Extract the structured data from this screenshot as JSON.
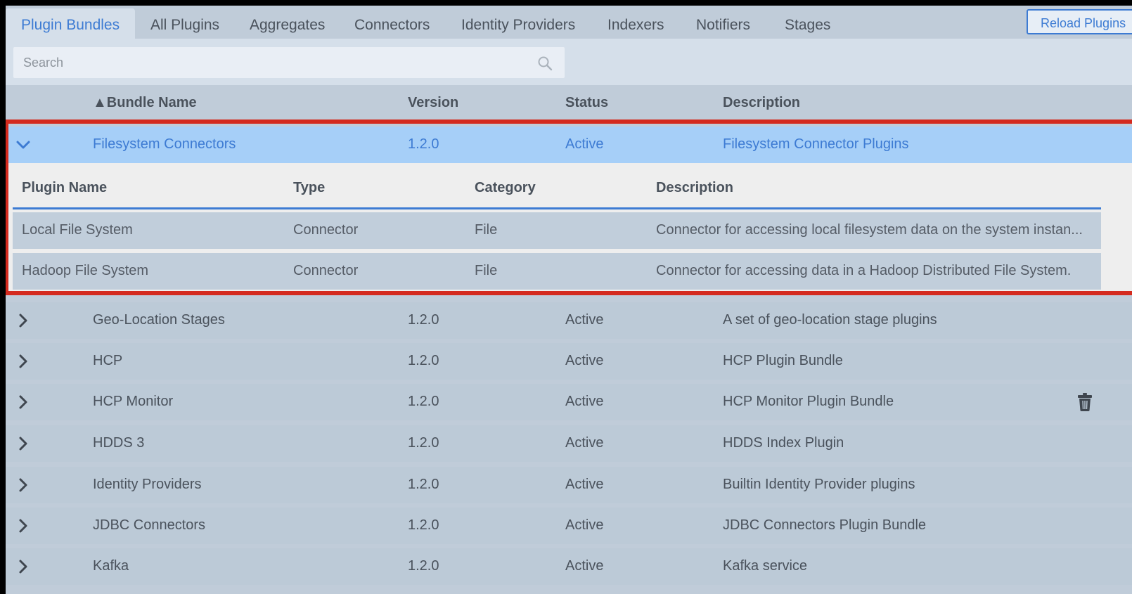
{
  "tabs": [
    {
      "label": "Plugin Bundles",
      "active": true
    },
    {
      "label": "All Plugins"
    },
    {
      "label": "Aggregates"
    },
    {
      "label": "Connectors"
    },
    {
      "label": "Identity Providers"
    },
    {
      "label": "Indexers"
    },
    {
      "label": "Notifiers"
    },
    {
      "label": "Stages"
    }
  ],
  "reload_label": "Reload Plugins",
  "search": {
    "placeholder": "Search",
    "value": ""
  },
  "columns": {
    "bundle_name": "▲Bundle Name",
    "version": "Version",
    "status": "Status",
    "description": "Description"
  },
  "expanded_bundle": {
    "name": "Filesystem Connectors",
    "version": "1.2.0",
    "status": "Active",
    "description": "Filesystem Connector Plugins"
  },
  "sub_columns": {
    "plugin_name": "Plugin Name",
    "type": "Type",
    "category": "Category",
    "description": "Description"
  },
  "plugins": [
    {
      "name": "Local File System",
      "type": "Connector",
      "category": "File",
      "description": "Connector for accessing local filesystem data on the system instan..."
    },
    {
      "name": "Hadoop File System",
      "type": "Connector",
      "category": "File",
      "description": "Connector for accessing data in a Hadoop Distributed File System."
    }
  ],
  "bundles": [
    {
      "name": "Geo-Location Stages",
      "version": "1.2.0",
      "status": "Active",
      "description": "A set of geo-location stage plugins"
    },
    {
      "name": "HCP",
      "version": "1.2.0",
      "status": "Active",
      "description": "HCP Plugin Bundle"
    },
    {
      "name": "HCP Monitor",
      "version": "1.2.0",
      "status": "Active",
      "description": "HCP Monitor Plugin Bundle"
    },
    {
      "name": "HDDS 3",
      "version": "1.2.0",
      "status": "Active",
      "description": "HDDS Index Plugin"
    },
    {
      "name": "Identity Providers",
      "version": "1.2.0",
      "status": "Active",
      "description": "Builtin Identity Provider plugins"
    },
    {
      "name": "JDBC Connectors",
      "version": "1.2.0",
      "status": "Active",
      "description": "JDBC Connectors Plugin Bundle"
    },
    {
      "name": "Kafka",
      "version": "1.2.0",
      "status": "Active",
      "description": "Kafka service"
    }
  ],
  "colors": {
    "accent": "#3d7bd3",
    "highlight": "#d42a1e",
    "selected_row": "#a6cff8"
  }
}
